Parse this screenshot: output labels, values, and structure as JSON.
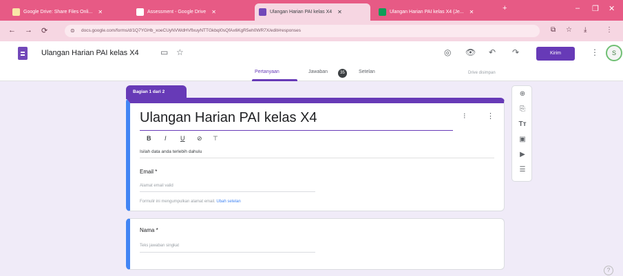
{
  "browser": {
    "tabs": [
      {
        "label": "Google Drive: Share Files Onli...",
        "icon_color": "#f9e6a7",
        "active": false
      },
      {
        "label": "Assessment - Google Drive",
        "icon_color": "#ffffff",
        "active": false
      },
      {
        "label": "Ulangan Harian PAI kelas X4",
        "icon_color": "#7248b9",
        "active": true
      },
      {
        "label": "Ulangan Harian PAI kelas X4 (Je...",
        "icon_color": "#0f9d58",
        "active": false
      }
    ],
    "new_tab": "+",
    "window_controls": {
      "minimize": "–",
      "maximize": "❐",
      "close": "✕"
    },
    "nav": {
      "back": "←",
      "forward": "→",
      "reload": "⟳"
    },
    "url": "docs.google.com/forms/d/1Q7YGHb_xoeCUyNVWdHVflxuyNTTGkbqI0sQfAx6KgR5eh0WR7X/edit#responses",
    "address_icons": {
      "star": "☆",
      "extensions": "⧉",
      "download": "⤓",
      "menu": "⋮"
    }
  },
  "header": {
    "doc_title": "Ulangan Harian PAI kelas X4",
    "icons": {
      "folder": "▭",
      "star": "☆",
      "palette": "◎",
      "preview": "👁",
      "undo": "↶",
      "redo": "↷",
      "more": "⋮"
    },
    "send_label": "Kirim",
    "avatar": "S",
    "tabs": [
      {
        "label": "Pertanyaan",
        "active": true
      },
      {
        "label": "Jawaban",
        "active": false
      },
      {
        "label": "Setelan",
        "active": false
      }
    ],
    "responses_badge": "35",
    "saved_status": "Drive disimpan"
  },
  "form": {
    "section_label": "Bagian 1 dari 2",
    "title": "Ulangan Harian PAI kelas X4",
    "format_tools": [
      "B",
      "I",
      "U",
      "⊘",
      "⊤"
    ],
    "description": "Isilah data anda terlebih dahulu",
    "email": {
      "label": "Email *",
      "placeholder": "Alamat email valid",
      "note": "Formulir ini mengumpulkan alamat email.",
      "note_link": "Ubah setelan"
    },
    "name_field": {
      "label": "Nama *",
      "placeholder": "Teks jawaban singkat"
    }
  },
  "toolbar": {
    "items": [
      "⊕",
      "⎘",
      "Tт",
      "▣",
      "▶",
      "☰"
    ]
  },
  "help_icon": "?"
}
